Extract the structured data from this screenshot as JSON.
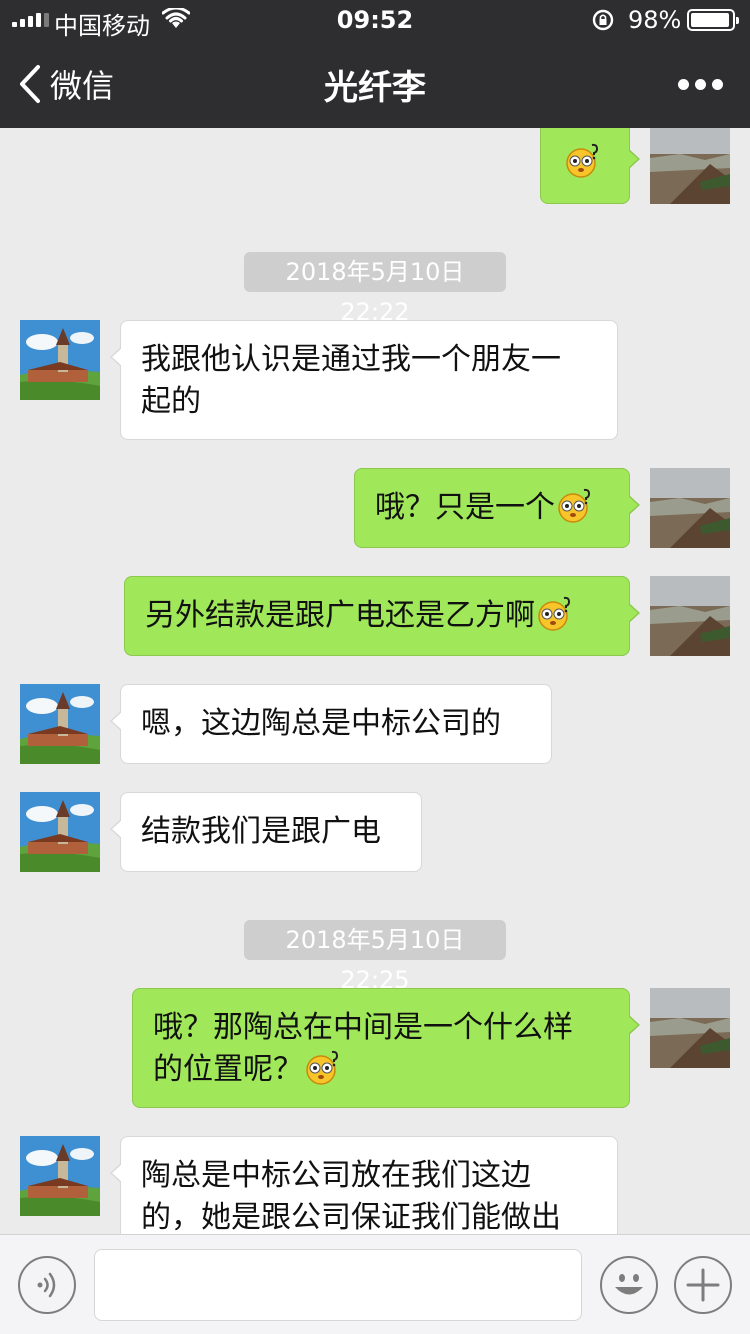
{
  "status_bar": {
    "carrier": "中国移动",
    "time": "09:52",
    "battery": "98%"
  },
  "nav": {
    "back_label": "微信",
    "title": "光纤李"
  },
  "messages": [
    {
      "type": "sent_emoji"
    },
    {
      "type": "timestamp",
      "text": "2018年5月10日 22:22"
    },
    {
      "type": "received",
      "lines": [
        "我跟他认识是通过我一个朋友一",
        "起的"
      ]
    },
    {
      "type": "sent",
      "lines": [
        "哦？只是一个"
      ],
      "emoji": true
    },
    {
      "type": "sent",
      "lines": [
        "另外结款是跟广电还是乙方啊"
      ],
      "emoji": true
    },
    {
      "type": "received",
      "lines": [
        "嗯，这边陶总是中标公司的"
      ]
    },
    {
      "type": "received",
      "lines": [
        "结款我们是跟广电"
      ]
    },
    {
      "type": "timestamp",
      "text": "2018年5月10日 22:25"
    },
    {
      "type": "sent",
      "lines": [
        "哦？那陶总在中间是一个什么样",
        "的位置呢？"
      ],
      "emoji": true
    },
    {
      "type": "received",
      "lines": [
        "陶总是中标公司放在我们这边",
        "的，她是跟公司保证我们能做出"
      ]
    }
  ],
  "icons": {
    "back": "chevron-left-icon",
    "more": "more-dots-icon",
    "voice": "voice-icon",
    "emoji": "smiley-icon",
    "plus": "plus-icon",
    "bubble_emoji": "dizzy-face-emoji"
  },
  "colors": {
    "nav_bg": "#2e2e31",
    "chat_bg": "#ebebeb",
    "sent_bubble": "#a0e75a",
    "received_bubble": "#ffffff",
    "timestamp_bg": "#cecece"
  }
}
